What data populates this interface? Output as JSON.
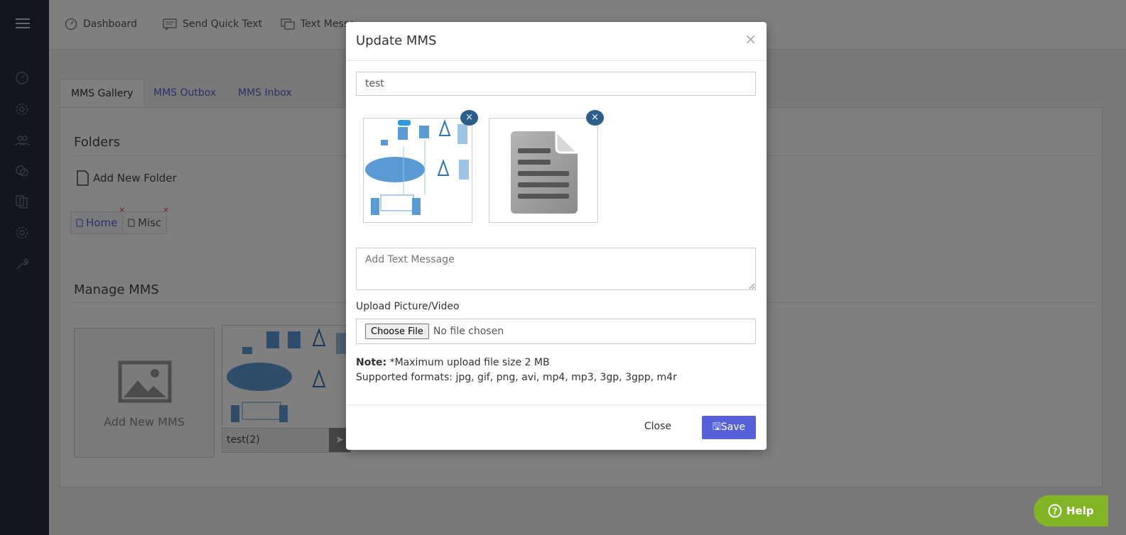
{
  "topnav": {
    "items": [
      {
        "label": "Dashboard",
        "icon": "dashboard-icon"
      },
      {
        "label": "Send Quick Text",
        "icon": "message-icon"
      },
      {
        "label": "Text Messe",
        "icon": "chat-icon"
      }
    ]
  },
  "tabs": [
    {
      "label": "MMS Gallery",
      "active": true
    },
    {
      "label": "MMS Outbox",
      "active": false
    },
    {
      "label": "MMS Inbox",
      "active": false
    }
  ],
  "folders": {
    "title": "Folders",
    "add_label": "Add New Folder",
    "items": [
      {
        "label": "Home",
        "remove": "×"
      },
      {
        "label": "Misc",
        "remove": "×"
      }
    ]
  },
  "manage": {
    "title": "Manage MMS",
    "add_label": "Add New MMS",
    "cards": [
      {
        "caption": "test(2)"
      }
    ]
  },
  "modal": {
    "title": "Update MMS",
    "close_x": "×",
    "name_value": "test",
    "remove_label": "×",
    "text_placeholder": "Add Text Message",
    "upload_label": "Upload Picture/Video",
    "choose_file": "Choose File",
    "no_file": "No file chosen",
    "note_bold": "Note:",
    "note_text": " *Maximum upload file size 2 MB",
    "formats": "Supported formats: jpg, gif, png, avi, mp4, mp3, 3gp, 3gpp, m4r",
    "close_button": "Close",
    "save_button": "Save"
  },
  "help": {
    "label": "Help"
  },
  "colors": {
    "sidebar": "#272b3f",
    "accent": "#5660d8",
    "help": "#82b526",
    "remove_badge": "#2b5f8a"
  }
}
